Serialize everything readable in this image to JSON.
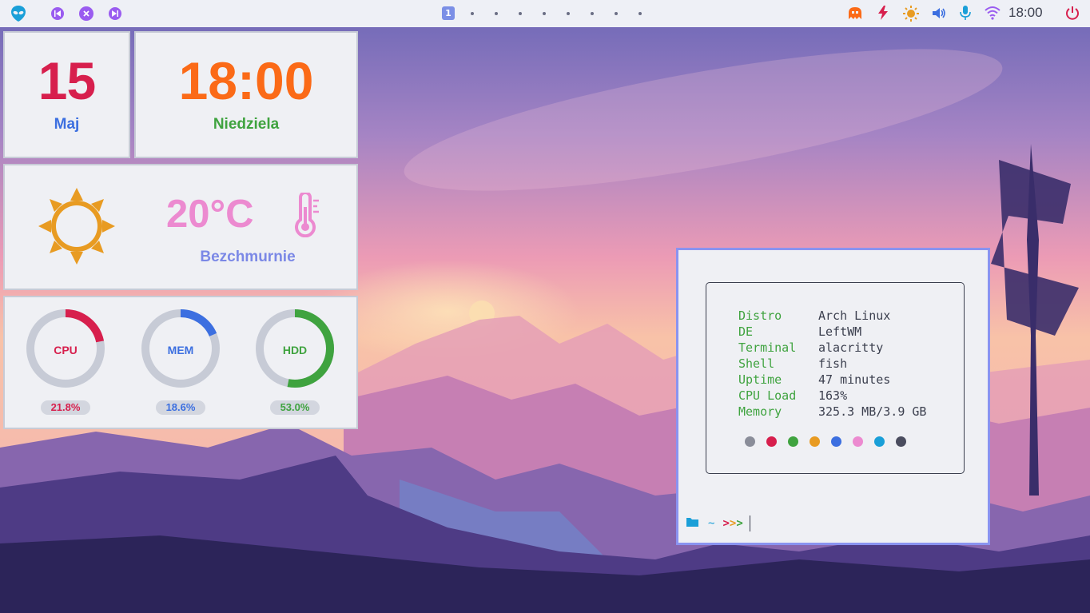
{
  "topbar": {
    "logo_icon": "alien-head-icon",
    "media": [
      "previous-track-icon",
      "close-icon",
      "next-track-icon"
    ],
    "workspaces": [
      "1",
      "",
      "",
      "",
      "",
      "",
      "",
      "",
      ""
    ],
    "active_workspace": "1",
    "tray": [
      "ghost-icon",
      "lightning-icon",
      "brightness-icon",
      "volume-icon",
      "microphone-icon",
      "wifi-icon"
    ],
    "clock": "18:00",
    "power_icon": "power-icon"
  },
  "date_widget": {
    "day": "15",
    "month": "Maj"
  },
  "time_widget": {
    "time": "18:00",
    "weekday": "Niedziela"
  },
  "weather_widget": {
    "temperature": "20°C",
    "condition": "Bezchmurnie",
    "icon": "sun-icon",
    "thermo_icon": "thermometer-icon"
  },
  "system_widget": {
    "gauges": [
      {
        "label": "CPU",
        "percent_text": "21.8%",
        "value": 21.8,
        "color": "#d71f4d"
      },
      {
        "label": "MEM",
        "percent_text": "18.6%",
        "value": 18.6,
        "color": "#3c6fe0"
      },
      {
        "label": "HDD",
        "percent_text": "53.0%",
        "value": 53.0,
        "color": "#3fa33f"
      }
    ]
  },
  "terminal": {
    "info": [
      {
        "key": "Distro",
        "value": "Arch Linux"
      },
      {
        "key": "DE",
        "value": "LeftWM"
      },
      {
        "key": "Terminal",
        "value": "alacritty"
      },
      {
        "key": "Shell",
        "value": "fish"
      },
      {
        "key": "Uptime",
        "value": "47 minutes"
      },
      {
        "key": "CPU Load",
        "value": "163%"
      },
      {
        "key": "Memory",
        "value": "325.3 MB/3.9 GB"
      }
    ],
    "palette": [
      "#8a8d99",
      "#d71f4d",
      "#3fa33f",
      "#e89b22",
      "#3c6fe0",
      "#ec8ad0",
      "#1a9fd8",
      "#4a4c5e"
    ],
    "prompt": {
      "dir": "~",
      "arrows": ">>>"
    }
  },
  "colors": {
    "bar_bg": "#eef0f6",
    "widget_bg": "#eff0f4",
    "accent_purple": "#9a5cf0",
    "terminal_border": "#8a93f0"
  }
}
